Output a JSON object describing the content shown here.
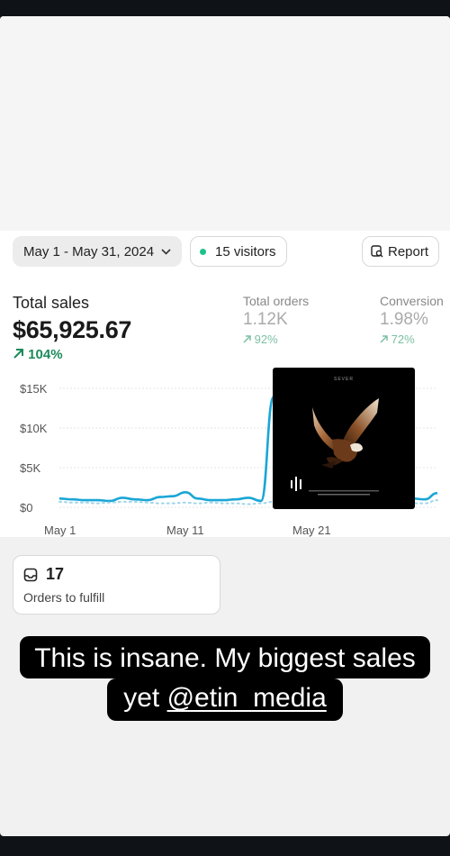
{
  "filters": {
    "date_range": "May 1 - May 31, 2024",
    "visitors": "15 visitors",
    "report_label": "Report"
  },
  "metrics": {
    "total_sales": {
      "label": "Total sales",
      "value": "$65,925.67",
      "change": "104%"
    },
    "total_orders": {
      "label": "Total orders",
      "value": "1.12K",
      "change": "92%"
    },
    "conversion": {
      "label": "Conversion",
      "value": "1.98%",
      "change": "72%"
    }
  },
  "chart_data": {
    "type": "line",
    "y_ticks": [
      "$15K",
      "$10K",
      "$5K",
      "$0"
    ],
    "x_ticks": [
      "May 1",
      "May 11",
      "May 21"
    ],
    "ylim": [
      0,
      15000
    ],
    "grid": true,
    "series": [
      {
        "style": "solid",
        "color": "#1aa6d6",
        "values": [
          1100,
          1000,
          900,
          900,
          800,
          1200,
          1000,
          900,
          1300,
          1400,
          1900,
          1100,
          900,
          900,
          1000,
          1200,
          800,
          13900,
          2000,
          1500,
          1200,
          1100,
          1000,
          1000,
          1000,
          1100,
          1000,
          1000,
          1100,
          1000,
          1800
        ]
      },
      {
        "style": "dotted",
        "color": "#9fd6ea",
        "values": [
          700,
          600,
          600,
          500,
          600,
          700,
          700,
          600,
          500,
          500,
          600,
          500,
          600,
          500,
          500,
          400,
          500,
          700,
          600,
          600,
          500,
          500,
          600,
          600,
          500,
          500,
          600,
          500,
          500,
          500,
          900
        ]
      }
    ]
  },
  "overlay_image": {
    "title_text": "SEVER",
    "subject": "eagle-photo"
  },
  "fulfill": {
    "count": "17",
    "label": "Orders to fulfill"
  },
  "caption": {
    "line1": "This is insane. My biggest sales",
    "line2_prefix": "yet ",
    "mention": "@etin_media"
  }
}
